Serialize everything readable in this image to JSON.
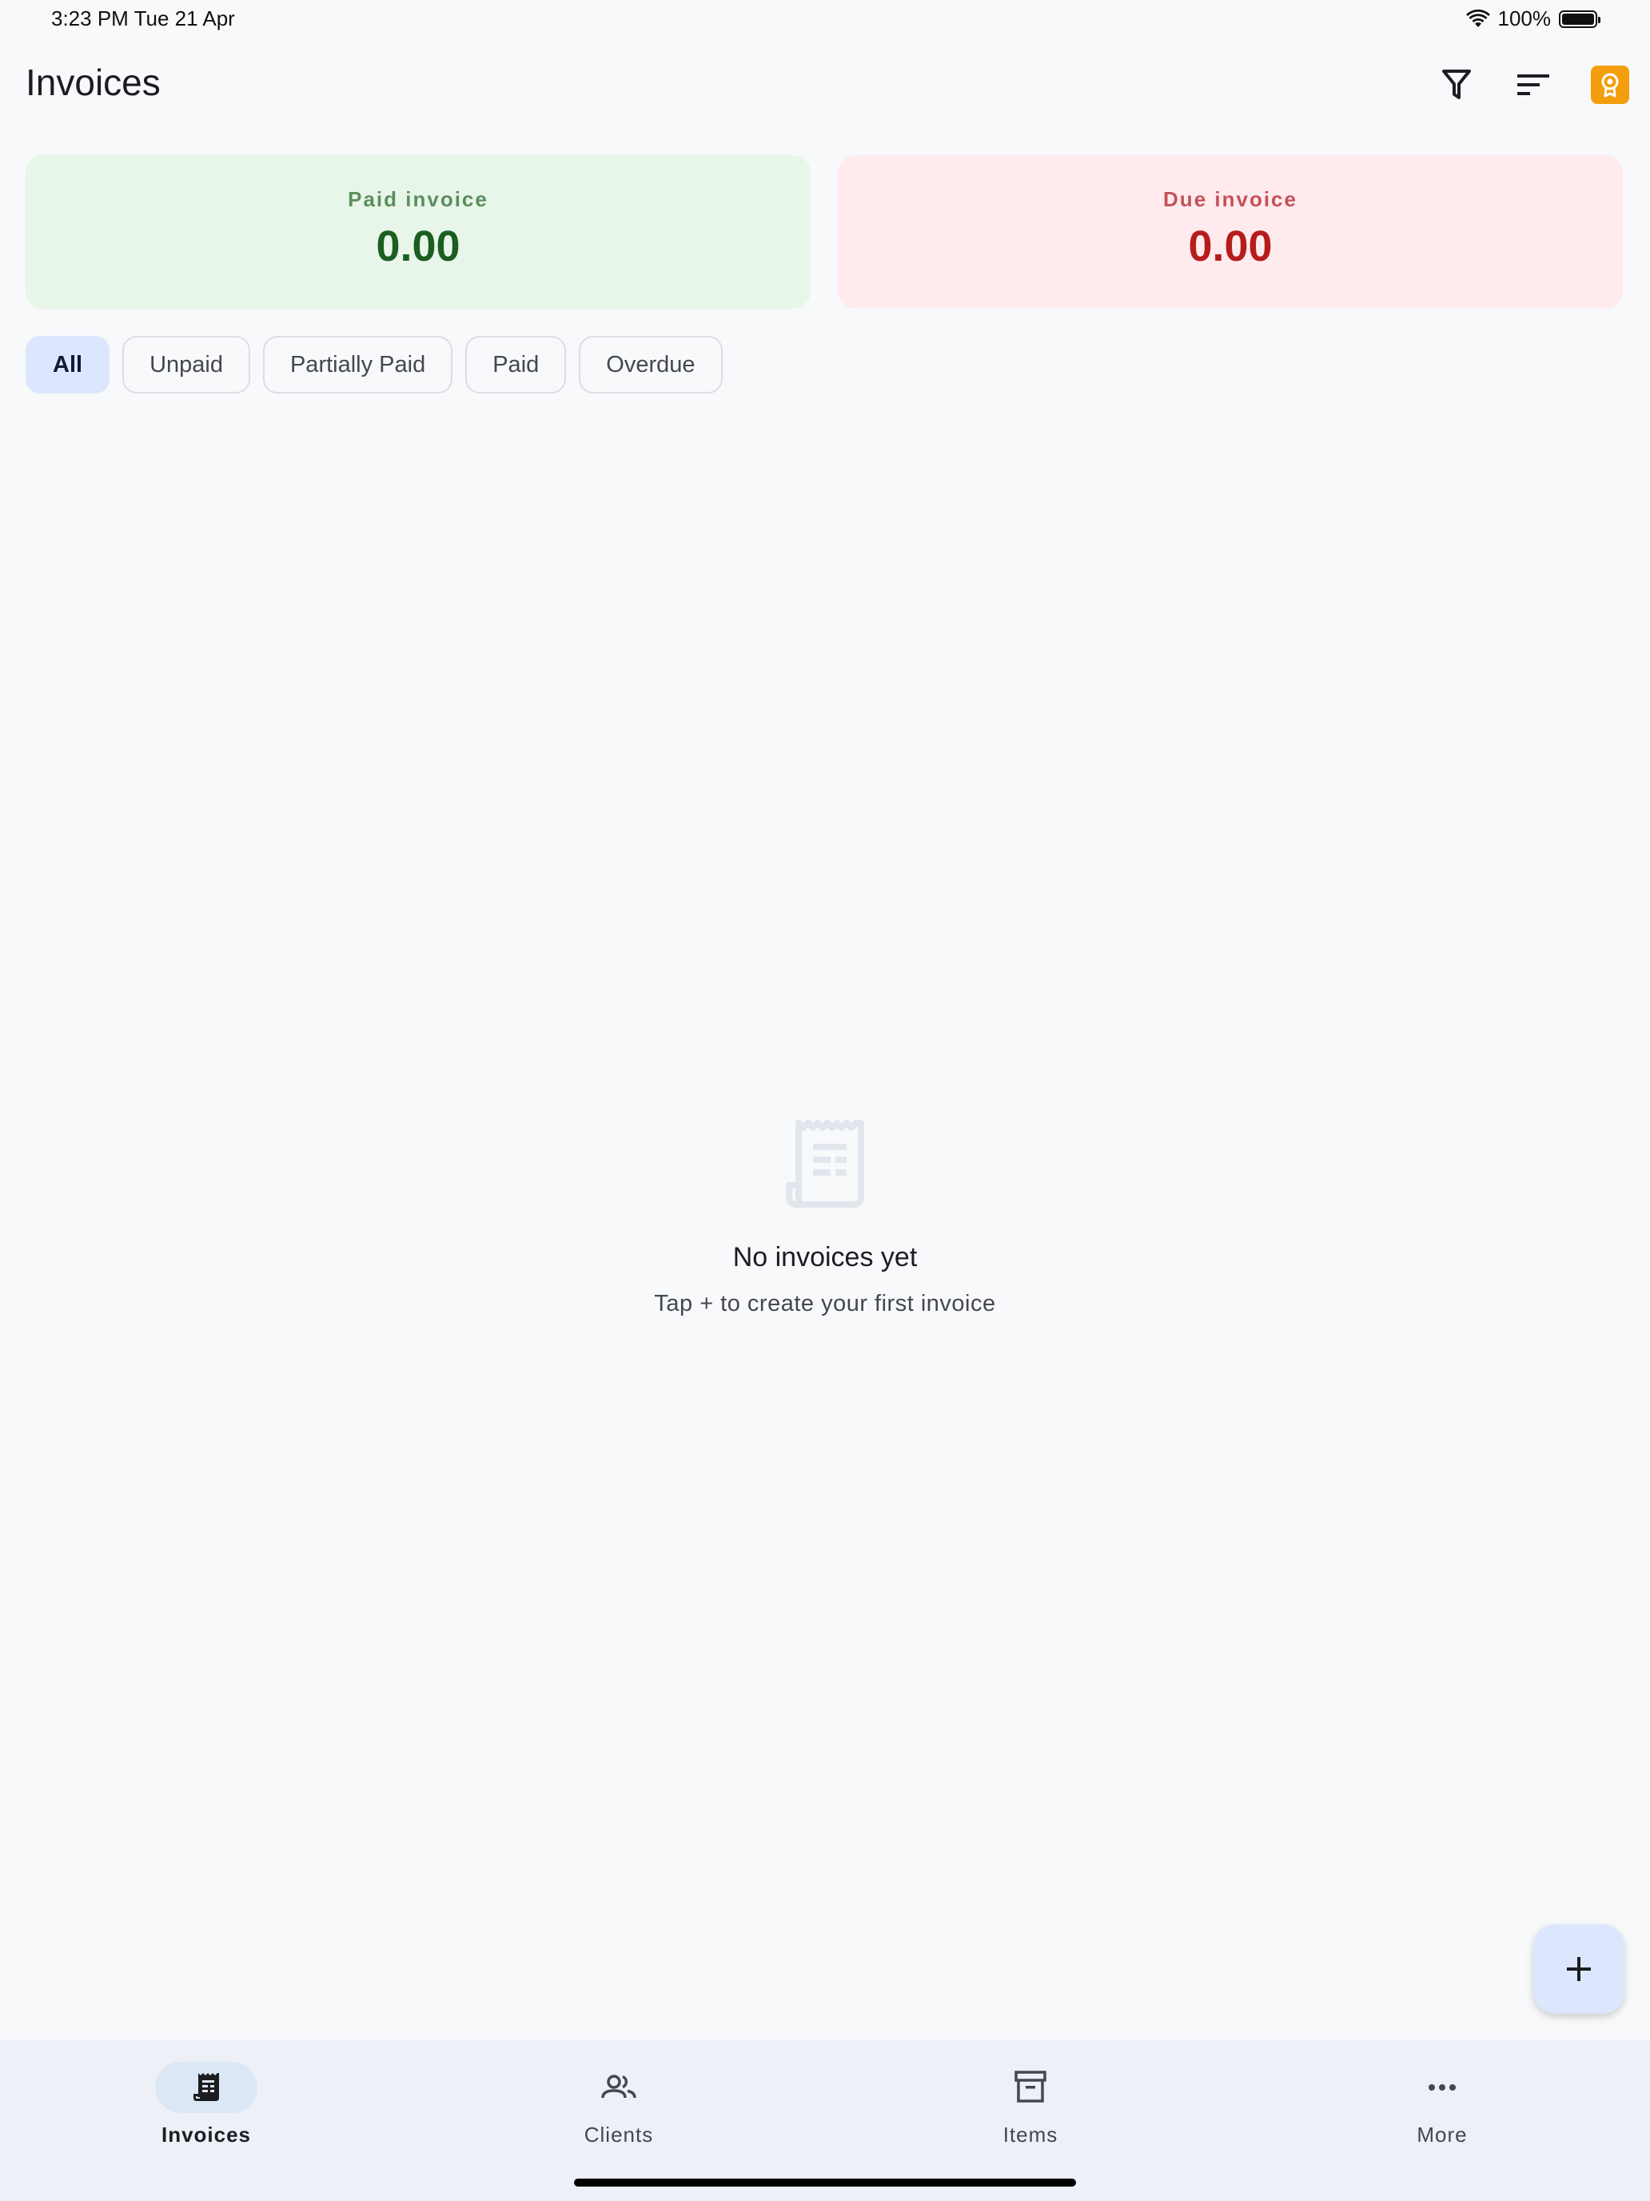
{
  "status_bar": {
    "time": "3:23 PM   Tue 21 Apr",
    "battery": "100%"
  },
  "app_bar": {
    "title": "Invoices",
    "filter_icon": "filter-icon",
    "sort_icon": "sort-icon",
    "premium_icon": "premium-badge-icon"
  },
  "summary": {
    "paid_label": "Paid invoice",
    "paid_value": "0.00",
    "due_label": "Due invoice",
    "due_value": "0.00"
  },
  "filters": {
    "chips": [
      "All",
      "Unpaid",
      "Partially Paid",
      "Paid",
      "Overdue"
    ],
    "selected": "All"
  },
  "empty_state": {
    "icon": "receipt-icon",
    "title": "No invoices yet",
    "subtitle": "Tap + to create your first invoice"
  },
  "fab": {
    "icon": "plus-icon"
  },
  "bottom_nav": {
    "items": [
      {
        "label": "Invoices",
        "icon": "receipt-icon",
        "active": true
      },
      {
        "label": "Clients",
        "icon": "people-icon",
        "active": false
      },
      {
        "label": "Items",
        "icon": "archive-box-icon",
        "active": false
      },
      {
        "label": "More",
        "icon": "more-horizontal-icon",
        "active": false
      }
    ]
  },
  "colors": {
    "background": "#f8f9fb",
    "paid_card_bg": "#e8f5e9",
    "paid_value": "#1b5e20",
    "due_card_bg": "#ffebee",
    "due_value": "#b71c1c",
    "accent_chip": "#dce7fd",
    "premium": "#f59e0b",
    "nav_bg": "#edf0f6"
  }
}
